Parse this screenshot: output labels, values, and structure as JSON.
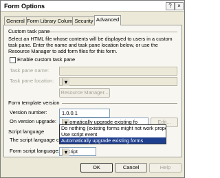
{
  "window": {
    "title": "Form Options",
    "help_btn": "?",
    "close_btn": "×"
  },
  "tabs": [
    {
      "label": "General"
    },
    {
      "label": "Form Library Columns"
    },
    {
      "label": "Security"
    },
    {
      "label": "Advanced"
    }
  ],
  "custom_task_pane": {
    "section_label": "Custom task pane",
    "description": "Select an HTML file whose contents will be displayed to users in a custom task pane. Enter the name and task pane location below, or use the Resource Manager to add form files for this form.",
    "enable_label": "Enable custom task pane",
    "enable_checked": false,
    "name_label": "Task pane name:",
    "name_value": "",
    "location_label": "Task pane location:",
    "location_value": "",
    "resource_manager_label": "Resource Manager..."
  },
  "form_template_version": {
    "section_label": "Form template version",
    "version_label": "Version number:",
    "version_value": "1.0.0.1",
    "on_upgrade_label": "On version upgrade:",
    "on_upgrade_value": "Automatically upgrade existing fo",
    "edit_label": "Edit...",
    "options": [
      "Do nothing (existing forms might not work properly)",
      "Use script event",
      "Automatically upgrade existing forms"
    ],
    "selected_option_index": 2
  },
  "script_language": {
    "section_label": "Script language",
    "description": "The script language can",
    "language_label": "Form script language:",
    "language_value": "JScript"
  },
  "footer": {
    "ok": "OK",
    "cancel": "Cancel",
    "help": "Help"
  }
}
